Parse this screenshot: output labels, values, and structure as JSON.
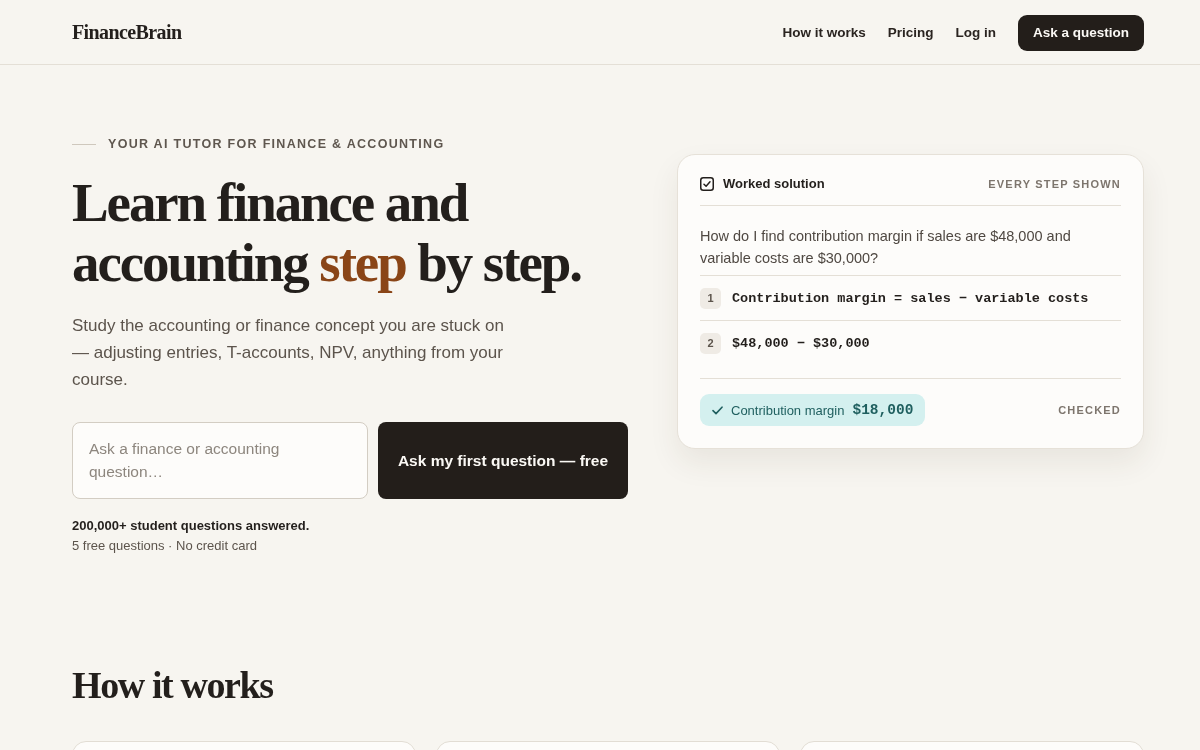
{
  "header": {
    "logo": "FinanceBrain",
    "nav": [
      {
        "label": "How it works"
      },
      {
        "label": "Pricing"
      },
      {
        "label": "Log in"
      }
    ],
    "cta": "Ask a question"
  },
  "hero": {
    "eyebrow": "YOUR AI TUTOR FOR FINANCE & ACCOUNTING",
    "headline": [
      {
        "text": "Learn finance and accounting ",
        "accent": false
      },
      {
        "text": "step",
        "accent": true
      },
      {
        "text": " by step.",
        "accent": false
      }
    ],
    "description": "Study the accounting or finance concept you are stuck on — adjusting entries, T-accounts, NPV, anything from your course.",
    "question_field": {
      "placeholder": "Ask a finance or accounting question…"
    },
    "submit": "Ask my first question — free",
    "proof": "200,000+ student questions answered.",
    "note": "5 free questions · No credit card"
  },
  "solution_card": {
    "title": "Worked solution",
    "tag": "EVERY STEP SHOWN",
    "question": "How do I find contribution margin if sales are $48,000 and variable costs are $30,000?",
    "steps": [
      {
        "number": "1",
        "formula": "Contribution margin = sales − variable costs"
      },
      {
        "number": "2",
        "formula": "$48,000 − $30,000"
      }
    ],
    "result": {
      "label": "Contribution margin",
      "value": "$18,000"
    },
    "status": "CHECKED"
  },
  "how_it_works": {
    "title": "How it works"
  }
}
